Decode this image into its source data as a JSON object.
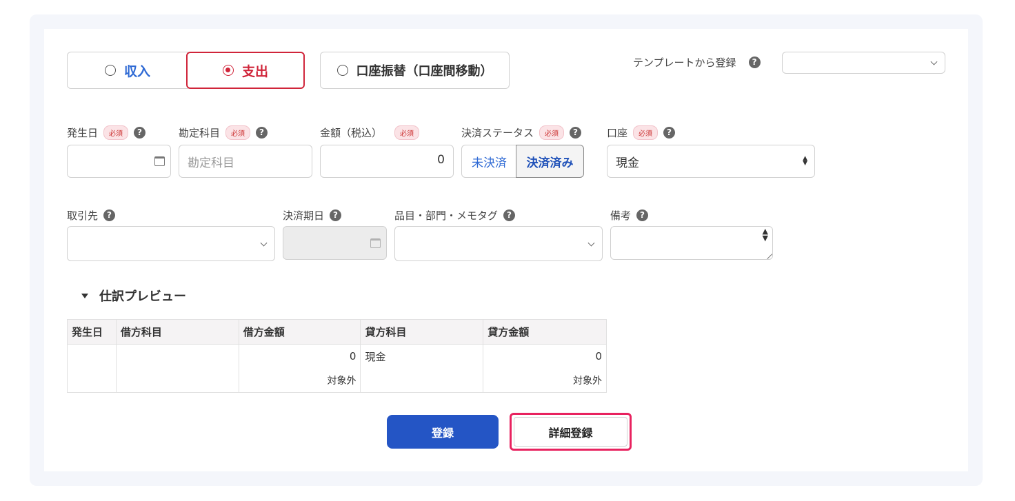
{
  "type_toggle": {
    "income": "収入",
    "expense": "支出",
    "transfer": "口座振替（口座間移動）"
  },
  "template": {
    "label": "テンプレートから登録",
    "value": ""
  },
  "required_badge": "必須",
  "help_icon_glyph": "?",
  "fields": {
    "date": {
      "label": "発生日",
      "value": ""
    },
    "account_title": {
      "label": "勘定科目",
      "placeholder": "勘定科目"
    },
    "amount": {
      "label": "金額（税込）",
      "value": "0"
    },
    "payment_status": {
      "label": "決済ステータス",
      "unpaid": "未決済",
      "paid": "決済済み",
      "selected": "決済済み"
    },
    "account": {
      "label": "口座",
      "value": "現金"
    },
    "partner": {
      "label": "取引先",
      "value": ""
    },
    "due_date": {
      "label": "決済期日",
      "value": ""
    },
    "items": {
      "label": "品目・部門・メモタグ",
      "value": ""
    },
    "memo": {
      "label": "備考",
      "value": ""
    }
  },
  "preview": {
    "title": "仕訳プレビュー",
    "headers": [
      "発生日",
      "借方科目",
      "借方金額",
      "貸方科目",
      "貸方金額"
    ],
    "row": {
      "date": "",
      "debit_account": "",
      "debit_amount": "0",
      "credit_account": "現金",
      "credit_amount": "0",
      "debit_tax": "対象外",
      "credit_tax": "対象外"
    }
  },
  "buttons": {
    "register": "登録",
    "detail_register": "詳細登録"
  },
  "colors": {
    "primary": "#2455c5",
    "expense_red": "#d0253a",
    "highlight_pink": "#e8225f",
    "link_blue": "#2f6ad4"
  }
}
